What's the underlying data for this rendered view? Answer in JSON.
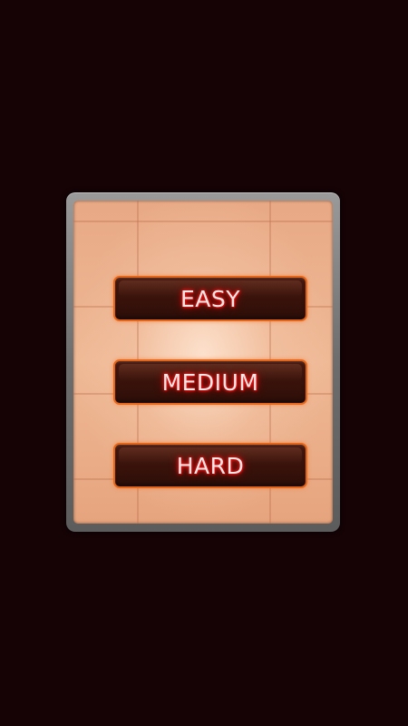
{
  "difficulty_menu": {
    "buttons": [
      {
        "id": "easy",
        "label": "EASY"
      },
      {
        "id": "medium",
        "label": "MEDIUM"
      },
      {
        "id": "hard",
        "label": "HARD"
      }
    ]
  },
  "colors": {
    "background": "#150306",
    "panel_frame": "#7a7a7a",
    "panel_fill": "#efb996",
    "button_fill": "#3a130b",
    "button_border": "#e4661a",
    "label_glow": "#ff2020"
  }
}
